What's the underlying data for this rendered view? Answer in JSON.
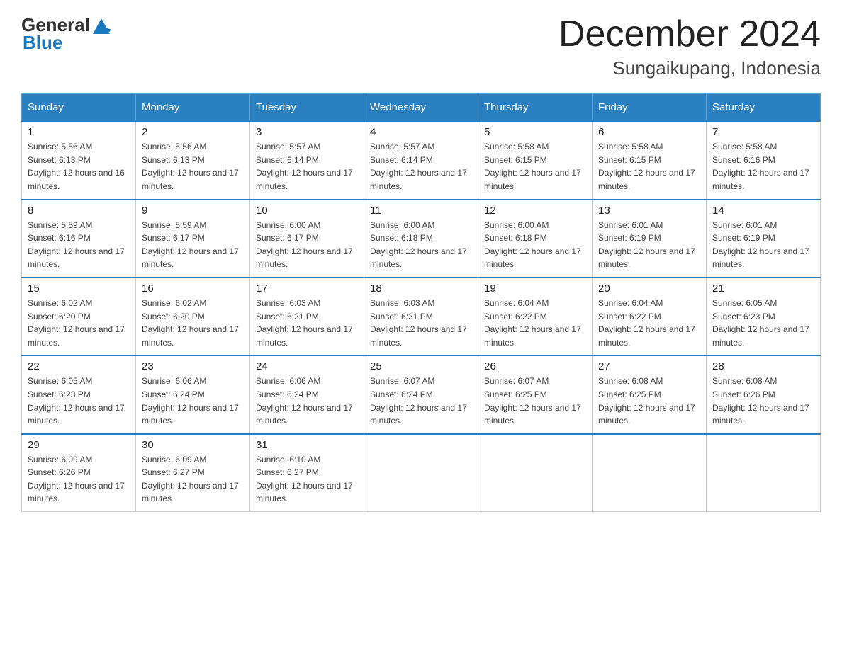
{
  "logo": {
    "text_general": "General",
    "text_blue": "Blue"
  },
  "title": {
    "month_year": "December 2024",
    "location": "Sungaikupang, Indonesia"
  },
  "days_of_week": [
    "Sunday",
    "Monday",
    "Tuesday",
    "Wednesday",
    "Thursday",
    "Friday",
    "Saturday"
  ],
  "weeks": [
    [
      {
        "day": "1",
        "sunrise": "5:56 AM",
        "sunset": "6:13 PM",
        "daylight": "12 hours and 16 minutes."
      },
      {
        "day": "2",
        "sunrise": "5:56 AM",
        "sunset": "6:13 PM",
        "daylight": "12 hours and 17 minutes."
      },
      {
        "day": "3",
        "sunrise": "5:57 AM",
        "sunset": "6:14 PM",
        "daylight": "12 hours and 17 minutes."
      },
      {
        "day": "4",
        "sunrise": "5:57 AM",
        "sunset": "6:14 PM",
        "daylight": "12 hours and 17 minutes."
      },
      {
        "day": "5",
        "sunrise": "5:58 AM",
        "sunset": "6:15 PM",
        "daylight": "12 hours and 17 minutes."
      },
      {
        "day": "6",
        "sunrise": "5:58 AM",
        "sunset": "6:15 PM",
        "daylight": "12 hours and 17 minutes."
      },
      {
        "day": "7",
        "sunrise": "5:58 AM",
        "sunset": "6:16 PM",
        "daylight": "12 hours and 17 minutes."
      }
    ],
    [
      {
        "day": "8",
        "sunrise": "5:59 AM",
        "sunset": "6:16 PM",
        "daylight": "12 hours and 17 minutes."
      },
      {
        "day": "9",
        "sunrise": "5:59 AM",
        "sunset": "6:17 PM",
        "daylight": "12 hours and 17 minutes."
      },
      {
        "day": "10",
        "sunrise": "6:00 AM",
        "sunset": "6:17 PM",
        "daylight": "12 hours and 17 minutes."
      },
      {
        "day": "11",
        "sunrise": "6:00 AM",
        "sunset": "6:18 PM",
        "daylight": "12 hours and 17 minutes."
      },
      {
        "day": "12",
        "sunrise": "6:00 AM",
        "sunset": "6:18 PM",
        "daylight": "12 hours and 17 minutes."
      },
      {
        "day": "13",
        "sunrise": "6:01 AM",
        "sunset": "6:19 PM",
        "daylight": "12 hours and 17 minutes."
      },
      {
        "day": "14",
        "sunrise": "6:01 AM",
        "sunset": "6:19 PM",
        "daylight": "12 hours and 17 minutes."
      }
    ],
    [
      {
        "day": "15",
        "sunrise": "6:02 AM",
        "sunset": "6:20 PM",
        "daylight": "12 hours and 17 minutes."
      },
      {
        "day": "16",
        "sunrise": "6:02 AM",
        "sunset": "6:20 PM",
        "daylight": "12 hours and 17 minutes."
      },
      {
        "day": "17",
        "sunrise": "6:03 AM",
        "sunset": "6:21 PM",
        "daylight": "12 hours and 17 minutes."
      },
      {
        "day": "18",
        "sunrise": "6:03 AM",
        "sunset": "6:21 PM",
        "daylight": "12 hours and 17 minutes."
      },
      {
        "day": "19",
        "sunrise": "6:04 AM",
        "sunset": "6:22 PM",
        "daylight": "12 hours and 17 minutes."
      },
      {
        "day": "20",
        "sunrise": "6:04 AM",
        "sunset": "6:22 PM",
        "daylight": "12 hours and 17 minutes."
      },
      {
        "day": "21",
        "sunrise": "6:05 AM",
        "sunset": "6:23 PM",
        "daylight": "12 hours and 17 minutes."
      }
    ],
    [
      {
        "day": "22",
        "sunrise": "6:05 AM",
        "sunset": "6:23 PM",
        "daylight": "12 hours and 17 minutes."
      },
      {
        "day": "23",
        "sunrise": "6:06 AM",
        "sunset": "6:24 PM",
        "daylight": "12 hours and 17 minutes."
      },
      {
        "day": "24",
        "sunrise": "6:06 AM",
        "sunset": "6:24 PM",
        "daylight": "12 hours and 17 minutes."
      },
      {
        "day": "25",
        "sunrise": "6:07 AM",
        "sunset": "6:24 PM",
        "daylight": "12 hours and 17 minutes."
      },
      {
        "day": "26",
        "sunrise": "6:07 AM",
        "sunset": "6:25 PM",
        "daylight": "12 hours and 17 minutes."
      },
      {
        "day": "27",
        "sunrise": "6:08 AM",
        "sunset": "6:25 PM",
        "daylight": "12 hours and 17 minutes."
      },
      {
        "day": "28",
        "sunrise": "6:08 AM",
        "sunset": "6:26 PM",
        "daylight": "12 hours and 17 minutes."
      }
    ],
    [
      {
        "day": "29",
        "sunrise": "6:09 AM",
        "sunset": "6:26 PM",
        "daylight": "12 hours and 17 minutes."
      },
      {
        "day": "30",
        "sunrise": "6:09 AM",
        "sunset": "6:27 PM",
        "daylight": "12 hours and 17 minutes."
      },
      {
        "day": "31",
        "sunrise": "6:10 AM",
        "sunset": "6:27 PM",
        "daylight": "12 hours and 17 minutes."
      },
      null,
      null,
      null,
      null
    ]
  ]
}
